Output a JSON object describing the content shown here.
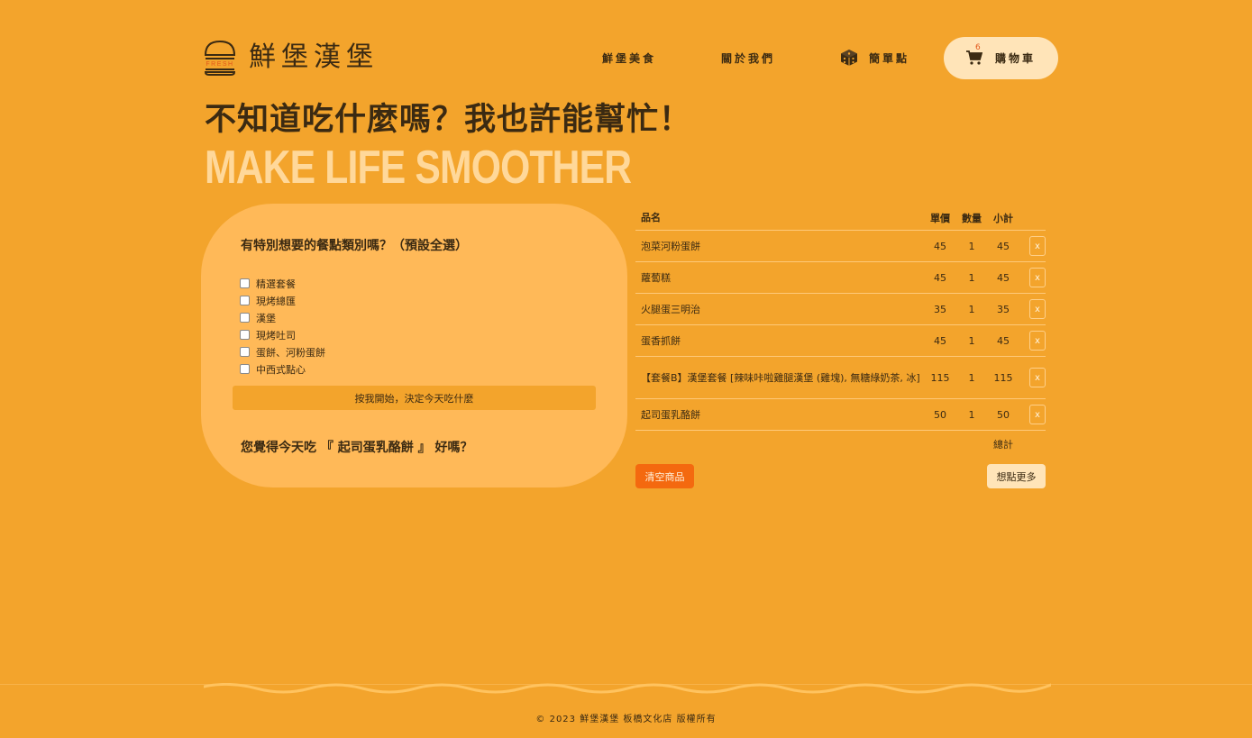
{
  "header": {
    "logo_text": "鮮堡漢堡",
    "logo_badge": "FRESH",
    "nav": [
      {
        "label": "鮮堡美食"
      },
      {
        "label": "關於我們"
      },
      {
        "label": "簡單點",
        "icon": "dice-icon"
      }
    ],
    "cart": {
      "label": "購物車",
      "count": "6",
      "icon": "cart-icon"
    }
  },
  "hero": {
    "headline": "不知道吃什麼嗎？我也許能幫忙！",
    "slogan": "MAKE LIFE SMOOTHER"
  },
  "picker": {
    "question": "有特別想要的餐點類別嗎？（預設全選）",
    "categories": [
      {
        "label": "精選套餐",
        "checked": false
      },
      {
        "label": "現烤總匯",
        "checked": false
      },
      {
        "label": "漢堡",
        "checked": false
      },
      {
        "label": "現烤吐司",
        "checked": false
      },
      {
        "label": "蛋餅、河粉蛋餅",
        "checked": false
      },
      {
        "label": "中西式點心",
        "checked": false
      }
    ],
    "start_button": "按我開始，決定今天吃什麼",
    "suggestion": "您覺得今天吃 『 起司蛋乳酪餅 』 好嗎？"
  },
  "cart_table": {
    "headers": {
      "name": "品名",
      "price": "單價",
      "qty": "數量",
      "subtotal": "小計"
    },
    "items": [
      {
        "name": "泡菜河粉蛋餅",
        "price": "45",
        "qty": "1",
        "subtotal": "45",
        "remove": "x"
      },
      {
        "name": "蘿蔔糕",
        "price": "45",
        "qty": "1",
        "subtotal": "45",
        "remove": "x"
      },
      {
        "name": "火腿蛋三明治",
        "price": "35",
        "qty": "1",
        "subtotal": "35",
        "remove": "x"
      },
      {
        "name": "蛋香抓餅",
        "price": "45",
        "qty": "1",
        "subtotal": "45",
        "remove": "x"
      },
      {
        "name": "【套餐B】漢堡套餐 [辣味咔啦雞腿漢堡 (雞塊), 無糖綠奶茶, 冰]",
        "price": "115",
        "qty": "1",
        "subtotal": "115",
        "remove": "x"
      },
      {
        "name": "起司蛋乳酪餅",
        "price": "50",
        "qty": "1",
        "subtotal": "50",
        "remove": "x"
      }
    ],
    "total_label": "總計",
    "clear_button": "清空商品",
    "more_button": "想點更多"
  },
  "footer": {
    "copyright": "© 2023 鮮堡漢堡 板橋文化店 版權所有"
  },
  "colors": {
    "background": "#f3a42c",
    "panel": "#ffb958",
    "cream": "#ffe4b8",
    "slogan": "#ffd89a",
    "accent": "#f4690f",
    "text": "#3b2a12"
  }
}
